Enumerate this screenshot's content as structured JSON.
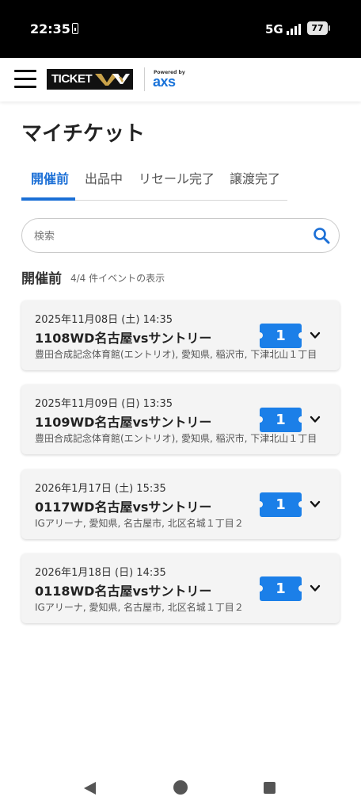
{
  "status_bar": {
    "time": "22:35",
    "network": "5G",
    "battery": "77"
  },
  "header": {
    "logo_text": "TICKET",
    "powered_by": "Powered by",
    "partner": "axs",
    "menu_icon": "hamburger-menu-icon"
  },
  "page": {
    "title": "マイチケット"
  },
  "tabs": [
    {
      "label": "開催前",
      "active": true
    },
    {
      "label": "出品中",
      "active": false
    },
    {
      "label": "リセール完了",
      "active": false
    },
    {
      "label": "譲渡完了",
      "active": false
    }
  ],
  "search": {
    "placeholder": "検索",
    "value": "",
    "icon": "search-icon"
  },
  "section": {
    "heading": "開催前",
    "count_text": "4/4 件イベントの表示"
  },
  "events": [
    {
      "date": "2025年11月08日 (土) 14:35",
      "title": "1108WD名古屋vsサントリー",
      "venue": "豊田合成記念体育館(エントリオ), 愛知県, 稲沢市, 下津北山１丁目",
      "tickets": "1"
    },
    {
      "date": "2025年11月09日 (日) 13:35",
      "title": "1109WD名古屋vsサントリー",
      "venue": "豊田合成記念体育館(エントリオ), 愛知県, 稲沢市, 下津北山１丁目",
      "tickets": "1"
    },
    {
      "date": "2026年1月17日 (土) 15:35",
      "title": "0117WD名古屋vsサントリー",
      "venue": "IGアリーナ, 愛知県, 名古屋市, 北区名城１丁目２",
      "tickets": "1"
    },
    {
      "date": "2026年1月18日 (日) 14:35",
      "title": "0118WD名古屋vsサントリー",
      "venue": "IGアリーナ, 愛知県, 名古屋市, 北区名城１丁目２",
      "tickets": "1"
    }
  ],
  "colors": {
    "accent": "#1b6fd6",
    "ticket_badge": "#1b7fe8",
    "axs_blue": "#1a73d9"
  }
}
